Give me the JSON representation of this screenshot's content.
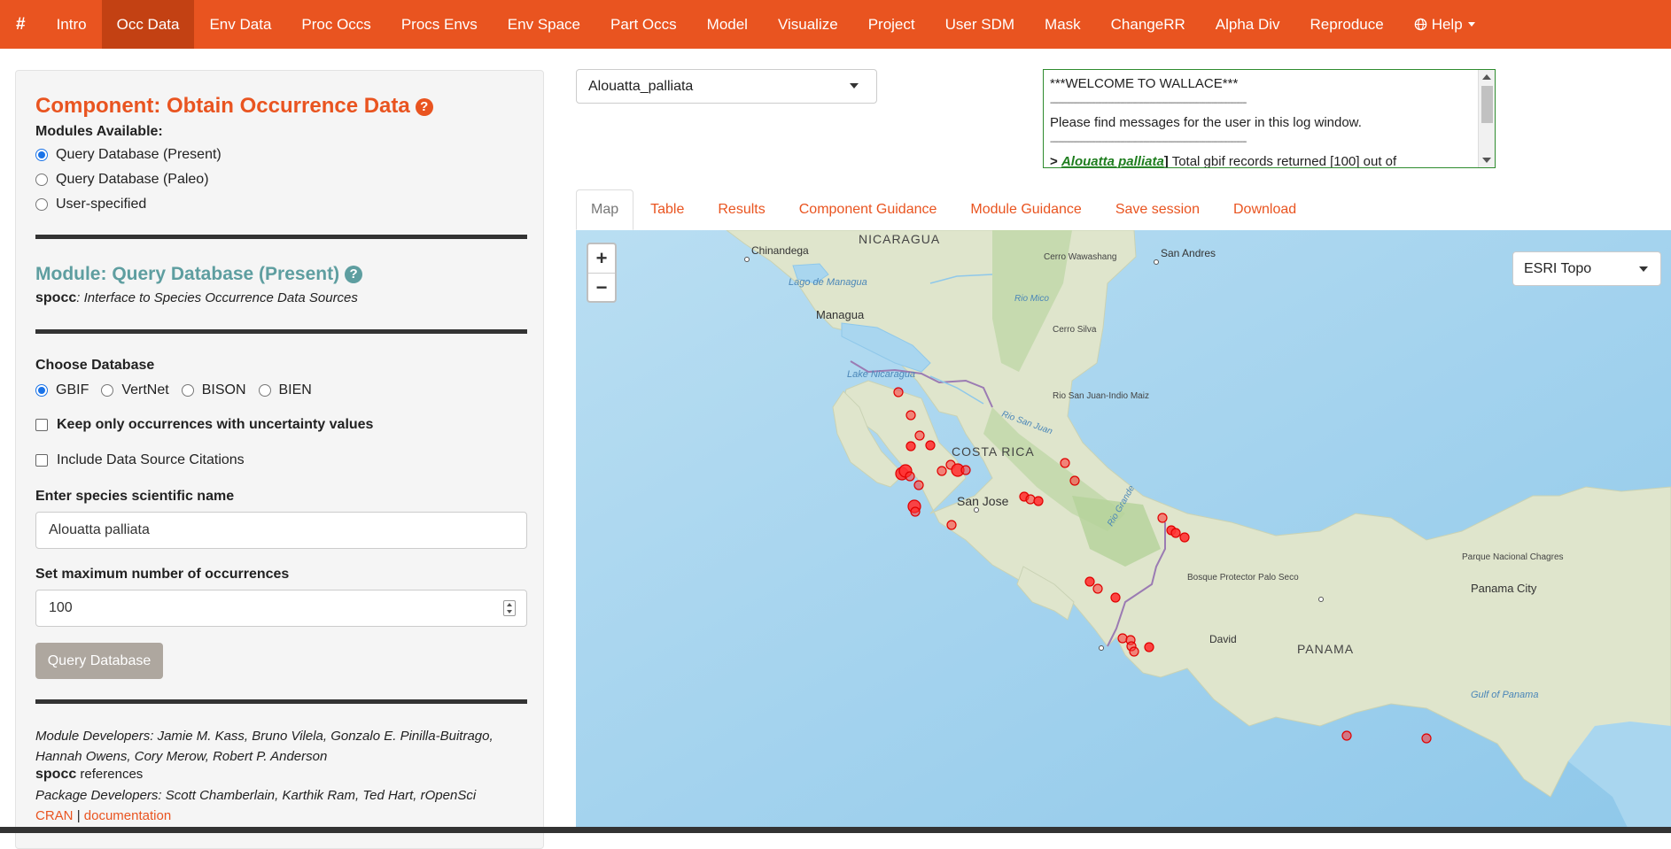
{
  "navbar": {
    "brand": "#",
    "items": [
      "Intro",
      "Occ Data",
      "Env Data",
      "Proc Occs",
      "Procs Envs",
      "Env Space",
      "Part Occs",
      "Model",
      "Visualize",
      "Project",
      "User SDM",
      "Mask",
      "ChangeRR",
      "Alpha Div",
      "Reproduce"
    ],
    "active": "Occ Data",
    "help": "Help",
    "brand_color": "#e95420"
  },
  "sidebar": {
    "component_title": "Component: Obtain Occurrence Data",
    "modules_label": "Modules Available:",
    "modules": [
      "Query Database (Present)",
      "Query Database (Paleo)",
      "User-specified"
    ],
    "module_title": "Module: Query Database (Present)",
    "package_name": "spocc",
    "package_desc": ": Interface to Species Occurrence Data Sources",
    "choose_db_label": "Choose Database",
    "databases": [
      "GBIF",
      "VertNet",
      "BISON",
      "BIEN"
    ],
    "keep_uncertainty_label": "Keep only occurrences with uncertainty values",
    "include_citations_label": "Include Data Source Citations",
    "species_label": "Enter species scientific name",
    "species_value": "Alouatta palliata",
    "max_occ_label": "Set maximum number of occurrences",
    "max_occ_value": "100",
    "query_button": "Query Database",
    "module_devs": "Module Developers: Jamie M. Kass, Bruno Vilela, Gonzalo E. Pinilla-Buitrago, Hannah Owens, Cory Merow, Robert P. Anderson",
    "refs_pkg": "spocc",
    "refs_word": "references",
    "package_devs": "Package Developers: Scott Chamberlain, Karthik Ram, Ted Hart, rOpenSci",
    "cran_link": "CRAN",
    "sep": "|",
    "doc_link": "documentation"
  },
  "species_select": "Alouatta_palliata",
  "log": {
    "welcome": "***WELCOME TO WALLACE***",
    "dashes": "-----------------------------------------------------------------------------------------------",
    "message": "Please find messages for the user in this log window.",
    "prefix": "> ",
    "species": "Alouatta palliata",
    "bracket": "]",
    "record_text": " Total gbif records returned [100] out of"
  },
  "tabs": [
    "Map",
    "Table",
    "Results",
    "Component Guidance",
    "Module Guidance",
    "Save session",
    "Download"
  ],
  "active_tab": "Map",
  "map": {
    "zoom_in": "+",
    "zoom_out": "−",
    "basemap": "ESRI Topo",
    "labels": {
      "nicaragua": "NICARAGUA",
      "costa_rica": "COSTA RICA",
      "panama": "PANAMA",
      "chinandega": "Chinandega",
      "managua": "Managua",
      "lago_managua": "Lago de Managua",
      "cerro_wawashang": "Cerro Wawashang",
      "rio_mico": "Rio Mico",
      "cerro_silva": "Cerro Silva",
      "lake_nicaragua": "Lake Nicaragua",
      "rio_san_juan": "Rio San Juan",
      "rio_san_juan_indio": "Rio San Juan-Indio Maiz",
      "san_jose": "San Jose",
      "san_andres": "San Andres",
      "bosque": "Bosque Protector Palo Seco",
      "david": "David",
      "parque": "Parque Nacional Chagres",
      "panama_city": "Panama City",
      "gulf": "Gulf of Panama",
      "rio_grande": "Rio Grande"
    },
    "occurrence_color": "#ff0000"
  }
}
